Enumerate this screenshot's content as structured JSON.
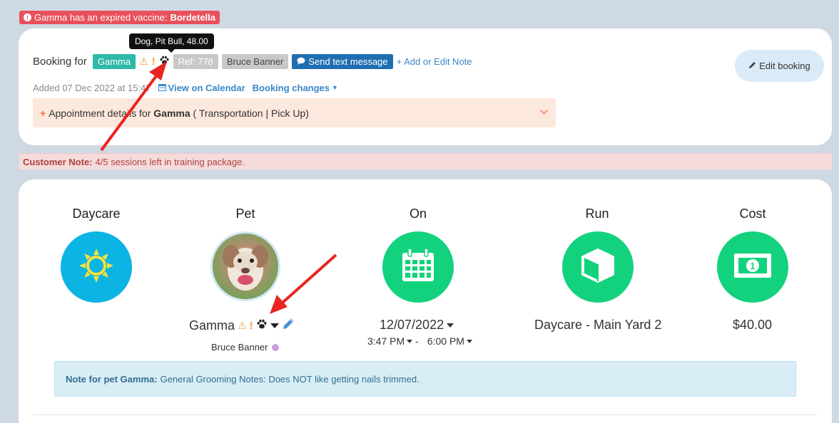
{
  "alert": {
    "prefix": "Gamma has an expired vaccine:",
    "vaccine": "Bordetella"
  },
  "tooltip": "Dog, Pit Bull, 48.00",
  "booking": {
    "label": "Booking for",
    "pet_tag": "Gamma",
    "ref": "Ref: 778",
    "owner": "Bruce Banner",
    "sms_button": "Send text message",
    "add_note": "+ Add or Edit Note",
    "added": "Added 07 Dec 2022 at 15:47",
    "view_calendar": "View on Calendar",
    "booking_changes": "Booking changes",
    "edit_button": "Edit booking"
  },
  "appointment": {
    "prefix": "Appointment details for",
    "pet": "Gamma",
    "suffix": "( Transportation | Pick Up)"
  },
  "customer_note": {
    "label": "Customer Note:",
    "text": "4/5 sessions left in training package."
  },
  "details": {
    "daycare_title": "Daycare",
    "pet_title": "Pet",
    "on_title": "On",
    "run_title": "Run",
    "cost_title": "Cost",
    "pet_name": "Gamma",
    "owner": "Bruce Banner",
    "date": "12/07/2022",
    "start_time": "3:47 PM",
    "separator": "-",
    "end_time": "6:00 PM",
    "run": "Daycare - Main Yard 2",
    "cost": "$40.00"
  },
  "pet_note": {
    "label": "Note for pet Gamma:",
    "text": "General Grooming Notes: Does NOT like getting nails trimmed."
  },
  "colors": {
    "teal": "#2fb9a8",
    "sms_blue": "#1f6fb0",
    "alert_red": "#e8505b",
    "daycare_blue": "#0cb4e4",
    "green": "#13d27e",
    "arrow_red": "#e8261f"
  }
}
